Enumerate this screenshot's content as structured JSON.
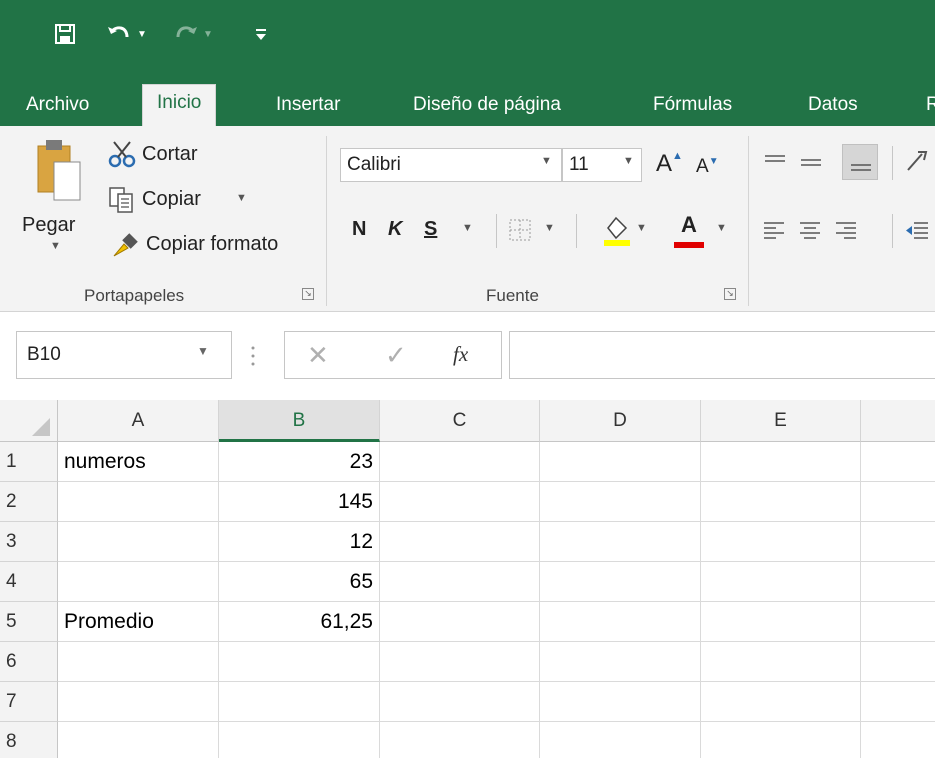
{
  "colors": {
    "brand": "#217346",
    "ribbon_bg": "#f3f3f3"
  },
  "qat": {
    "save_icon": "save-icon",
    "undo_icon": "undo-icon",
    "redo_icon": "redo-icon",
    "customize_icon": "customize-qat-icon"
  },
  "tabs": [
    {
      "label": "Archivo"
    },
    {
      "label": "Inicio",
      "active": true
    },
    {
      "label": "Insertar"
    },
    {
      "label": "Diseño de página"
    },
    {
      "label": "Fórmulas"
    },
    {
      "label": "Datos"
    },
    {
      "label": "R"
    }
  ],
  "clipboard": {
    "paste_label": "Pegar",
    "cut_label": "Cortar",
    "copy_label": "Copiar",
    "format_painter_label": "Copiar formato",
    "group_label": "Portapapeles"
  },
  "font": {
    "family": "Calibri",
    "size": "11",
    "bold_label": "N",
    "italic_label": "K",
    "underline_label": "S",
    "group_label": "Fuente"
  },
  "formula_bar": {
    "name_box": "B10",
    "fx_label": "fx",
    "content": ""
  },
  "sheet": {
    "columns": [
      "A",
      "B",
      "C",
      "D",
      "E"
    ],
    "selected_column": "B",
    "rows": [
      {
        "n": "1",
        "A": "numeros",
        "B": "23"
      },
      {
        "n": "2",
        "A": "",
        "B": "145"
      },
      {
        "n": "3",
        "A": "",
        "B": "12"
      },
      {
        "n": "4",
        "A": "",
        "B": "65"
      },
      {
        "n": "5",
        "A": "Promedio",
        "B": "61,25"
      },
      {
        "n": "6",
        "A": "",
        "B": ""
      },
      {
        "n": "7",
        "A": "",
        "B": ""
      },
      {
        "n": "8",
        "A": "",
        "B": ""
      }
    ]
  }
}
